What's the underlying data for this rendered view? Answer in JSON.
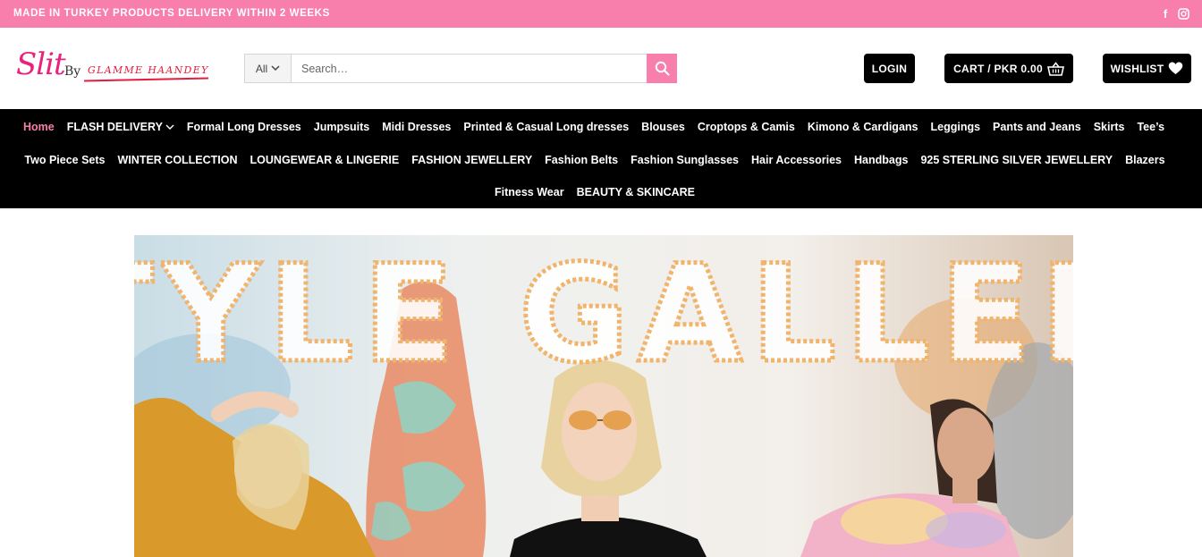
{
  "topbar": {
    "announcement": "MADE IN TURKEY PRODUCTS DELIVERY WITHIN 2 WEEKS",
    "social_icons": [
      "facebook-icon",
      "instagram-icon"
    ]
  },
  "logo": {
    "primary": "Slit",
    "by": "By",
    "brand": "GLAMME HAANDEY"
  },
  "search": {
    "category": "All",
    "placeholder": "Search…",
    "value": ""
  },
  "header_buttons": {
    "login": "LOGIN",
    "cart": "CART / PKR 0.00",
    "wishlist": "WISHLIST"
  },
  "nav": {
    "row1": [
      "Home",
      "FLASH DELIVERY",
      "Formal Long Dresses",
      "Jumpsuits",
      "Midi Dresses",
      "Printed & Casual Long dresses",
      "Blouses",
      "Croptops & Camis",
      "Kimono & Cardigans",
      "Leggings",
      "Pants and Jeans",
      "Skirts",
      "Tee’s"
    ],
    "row2": [
      "Two Piece Sets",
      "WINTER COLLECTION",
      "LOUNGEWEAR & LINGERIE",
      "FASHION JEWELLERY",
      "Fashion Belts",
      "Fashion Sunglasses",
      "Hair Accessories",
      "Handbags",
      "925 STERLING SILVER JEWELLERY",
      "Blazers"
    ],
    "row3": [
      "Fitness Wear",
      "BEAUTY & SKINCARE"
    ],
    "active": "Home"
  },
  "hero": {
    "headline": "STYLE GALLERY"
  },
  "colors": {
    "accent_pink": "#f87fab",
    "nav_bg": "#000000",
    "hero_headline_outline": "#f0b46c"
  }
}
